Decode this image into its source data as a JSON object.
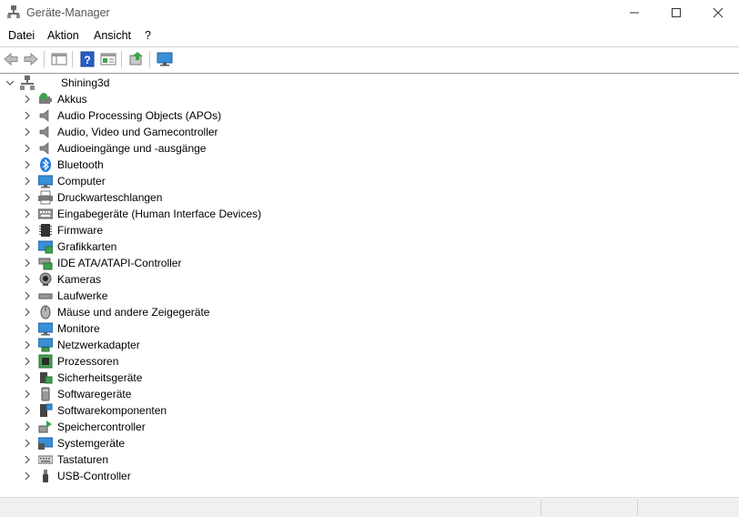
{
  "window": {
    "title": "Geräte-Manager",
    "icon": "device-manager-icon"
  },
  "menu": [
    "Datei",
    "Aktion",
    "Ansicht",
    "?"
  ],
  "toolbar": [
    {
      "name": "back-button",
      "icon": "arrow-left-icon"
    },
    {
      "name": "forward-button",
      "icon": "arrow-right-icon"
    },
    {
      "name": "show-hide-console-tree-button",
      "icon": "console-tree-icon"
    },
    {
      "name": "help-button",
      "icon": "help-icon"
    },
    {
      "name": "properties-button",
      "icon": "properties-icon"
    },
    {
      "name": "update-driver-button",
      "icon": "update-driver-icon"
    },
    {
      "name": "scan-hardware-button",
      "icon": "monitor-scan-icon"
    }
  ],
  "tree": {
    "root": {
      "label": "Shining3d",
      "icon": "computer-network-icon",
      "expanded": true
    },
    "items": [
      {
        "label": "Akkus",
        "icon": "battery-icon"
      },
      {
        "label": "Audio Processing Objects (APOs)",
        "icon": "speaker-icon"
      },
      {
        "label": "Audio, Video und Gamecontroller",
        "icon": "speaker-icon"
      },
      {
        "label": "Audioeingänge und -ausgänge",
        "icon": "speaker-icon"
      },
      {
        "label": "Bluetooth",
        "icon": "bluetooth-icon"
      },
      {
        "label": "Computer",
        "icon": "computer-icon"
      },
      {
        "label": "Druckwarteschlangen",
        "icon": "printer-icon"
      },
      {
        "label": "Eingabegeräte (Human Interface Devices)",
        "icon": "hid-icon"
      },
      {
        "label": "Firmware",
        "icon": "firmware-icon"
      },
      {
        "label": "Grafikkarten",
        "icon": "display-adapter-icon"
      },
      {
        "label": "IDE ATA/ATAPI-Controller",
        "icon": "ide-controller-icon"
      },
      {
        "label": "Kameras",
        "icon": "camera-icon"
      },
      {
        "label": "Laufwerke",
        "icon": "disk-drive-icon"
      },
      {
        "label": "Mäuse und andere Zeigegeräte",
        "icon": "mouse-icon"
      },
      {
        "label": "Monitore",
        "icon": "monitor-icon"
      },
      {
        "label": "Netzwerkadapter",
        "icon": "network-adapter-icon"
      },
      {
        "label": "Prozessoren",
        "icon": "processor-icon"
      },
      {
        "label": "Sicherheitsgeräte",
        "icon": "security-device-icon"
      },
      {
        "label": "Softwaregeräte",
        "icon": "software-device-icon"
      },
      {
        "label": "Softwarekomponenten",
        "icon": "software-component-icon"
      },
      {
        "label": "Speichercontroller",
        "icon": "storage-controller-icon"
      },
      {
        "label": "Systemgeräte",
        "icon": "system-devices-icon"
      },
      {
        "label": "Tastaturen",
        "icon": "keyboard-icon"
      },
      {
        "label": "USB-Controller",
        "icon": "usb-icon"
      }
    ]
  },
  "colors": {
    "accent": "#0078d4",
    "icon_blue": "#3a8fd6",
    "icon_green": "#3fa34d",
    "icon_gray": "#7a7a7a"
  }
}
